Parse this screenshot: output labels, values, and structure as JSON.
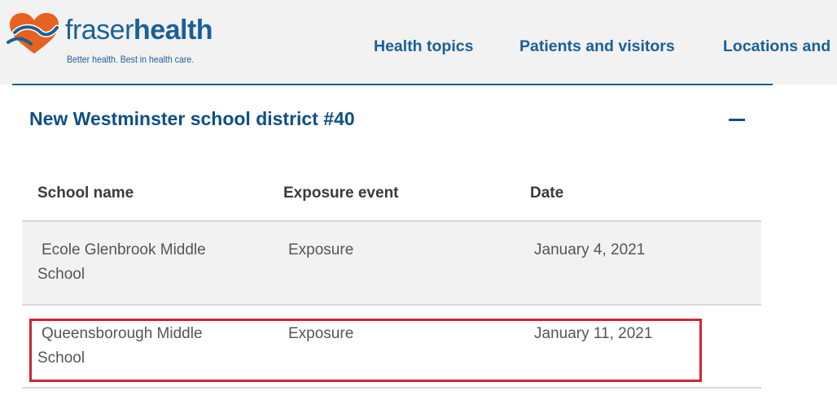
{
  "brand": {
    "name_light": "fraser",
    "name_bold": "health",
    "tagline": "Better health. Best in health care.",
    "colors": {
      "blue": "#1b5f98",
      "orange": "#e8621f",
      "highlight": "#d12631"
    }
  },
  "nav": {
    "items": [
      "Health topics",
      "Patients and visitors",
      "Locations and"
    ]
  },
  "section": {
    "title": "New Westminster school district #40",
    "toggle_icon": "minus-icon"
  },
  "table": {
    "headers": [
      "School name",
      "Exposure event",
      "Date"
    ],
    "rows": [
      {
        "school_line1": "Ecole Glenbrook Middle",
        "school_line2": "School",
        "event": "Exposure",
        "date": "January 4, 2021"
      },
      {
        "school_line1": "Queensborough Middle",
        "school_line2": "School",
        "event": "Exposure",
        "date": "January 11, 2021"
      }
    ]
  }
}
